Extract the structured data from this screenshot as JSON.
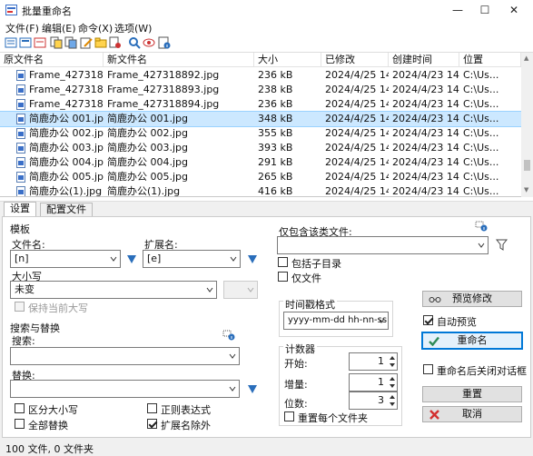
{
  "window": {
    "title": "批量重命名"
  },
  "menu": [
    "文件(F)",
    "编辑(E)",
    "命令(X)",
    "选项(W)"
  ],
  "list": {
    "headers": [
      "原文件名",
      "新文件名",
      "大小",
      "已修改",
      "创建时间",
      "位置"
    ],
    "rows": [
      [
        "Frame_4273188...",
        "Frame_427318892.jpg",
        "236 kB",
        "2024/4/25 14...",
        "2024/4/23 14...",
        "C:\\Us..."
      ],
      [
        "Frame_4273188...",
        "Frame_427318893.jpg",
        "238 kB",
        "2024/4/25 14...",
        "2024/4/23 14...",
        "C:\\Us..."
      ],
      [
        "Frame_4273188...",
        "Frame_427318894.jpg",
        "236 kB",
        "2024/4/25 14...",
        "2024/4/23 14...",
        "C:\\Us..."
      ],
      [
        "简鹿办公 001.jpg",
        "简鹿办公 001.jpg",
        "348 kB",
        "2024/4/25 14...",
        "2024/4/23 14...",
        "C:\\Us..."
      ],
      [
        "简鹿办公 002.jpg",
        "简鹿办公 002.jpg",
        "355 kB",
        "2024/4/25 14...",
        "2024/4/23 14...",
        "C:\\Us..."
      ],
      [
        "简鹿办公 003.jpg",
        "简鹿办公 003.jpg",
        "393 kB",
        "2024/4/25 14...",
        "2024/4/23 14...",
        "C:\\Us..."
      ],
      [
        "简鹿办公 004.jpg",
        "简鹿办公 004.jpg",
        "291 kB",
        "2024/4/25 14...",
        "2024/4/23 14...",
        "C:\\Us..."
      ],
      [
        "简鹿办公 005.jpg",
        "简鹿办公 005.jpg",
        "265 kB",
        "2024/4/25 14...",
        "2024/4/23 14...",
        "C:\\Us..."
      ],
      [
        "简鹿办公(1).jpg",
        "简鹿办公(1).jpg",
        "416 kB",
        "2024/4/25 14...",
        "2024/4/23 14...",
        "C:\\Us..."
      ]
    ],
    "selected_row": 3
  },
  "tabs": [
    "设置",
    "配置文件"
  ],
  "template": {
    "group": "模板",
    "filename_label": "文件名:",
    "filename_value": "[n]",
    "ext_label": "扩展名:",
    "ext_value": "[e]",
    "case_label": "大小写",
    "case_value": "未变",
    "keep_case": "保持当前大写"
  },
  "search": {
    "group": "搜索与替换",
    "search_label": "搜索:",
    "replace_label": "替换:",
    "case_sensitive": "区分大小写",
    "regex": "正则表达式",
    "replace_all": "全部替换",
    "exclude_ext": "扩展名除外"
  },
  "filter": {
    "label": "仅包含该类文件:",
    "include_subdirs": "包括子目录",
    "files_only": "仅文件"
  },
  "timestamp": {
    "group": "时间戳格式",
    "value": "yyyy-mm-dd hh-nn-ss"
  },
  "counter": {
    "group": "计数器",
    "start_label": "开始:",
    "start_value": "1",
    "step_label": "增量:",
    "step_value": "1",
    "digits_label": "位数:",
    "digits_value": "3",
    "reset_per_folder": "重置每个文件夹"
  },
  "actions": {
    "preview": "预览修改",
    "auto_preview": "自动预览",
    "rename": "重命名",
    "close_after": "重命名后关闭对话框",
    "reset": "重置",
    "cancel": "取消"
  },
  "status": {
    "text": "100 文件, 0 文件夹"
  },
  "colors": {
    "accent": "#2a6ebb",
    "selected_row": "#cce8ff",
    "rename_check": "#2e8b57",
    "cancel_x": "#d32f2f"
  }
}
